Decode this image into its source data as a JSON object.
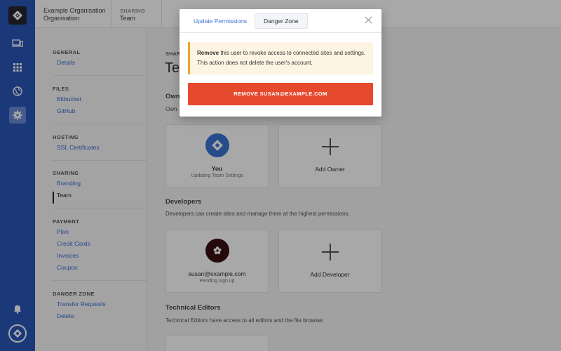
{
  "header": {
    "crumb1_line1": "Example Organisation",
    "crumb1_line2": "Organisation",
    "crumb2_line1": "SHARING",
    "crumb2_line2": "Team"
  },
  "rail": {
    "icons": [
      "logo-icon",
      "devices-icon",
      "apps-grid-icon",
      "globe-icon",
      "gear-icon",
      "bell-icon",
      "account-avatar-icon"
    ],
    "color": "#2a57b8"
  },
  "settings_nav": {
    "sections": [
      {
        "title": "GENERAL",
        "links": [
          "Details"
        ]
      },
      {
        "title": "FILES",
        "links": [
          "Bitbucket",
          "GitHub"
        ]
      },
      {
        "title": "HOSTING",
        "links": [
          "SSL Certificates"
        ]
      },
      {
        "title": "SHARING",
        "links": [
          "Branding",
          "Team"
        ]
      },
      {
        "title": "PAYMENT",
        "links": [
          "Plan",
          "Credit Cards",
          "Invoices",
          "Coupon"
        ]
      },
      {
        "title": "DANGER ZONE",
        "links": [
          "Transfer Requests",
          "Delete"
        ]
      }
    ],
    "current": "Team"
  },
  "main": {
    "label_fragment": "SHAR",
    "title_fragment": "Tea",
    "owners_heading_fragment": "Own",
    "owners_desc_fragment": "Own",
    "owner_card": {
      "name": "You",
      "sub": "Updating Team Settings"
    },
    "add_owner": "Add Owner",
    "developers_heading": "Developers",
    "developers_desc": "Developers can create sites and manage them at the highest permissions.",
    "developer_card": {
      "name": "susan@example.com",
      "sub": "Pending sign up"
    },
    "add_developer": "Add Developer",
    "editors_heading": "Technical Editors",
    "editors_desc": "Technical Editors have access to all editors and the file browser."
  },
  "modal": {
    "tabs": [
      "Update Permissions",
      "Danger Zone"
    ],
    "active_tab": "Danger Zone",
    "warning_bold": "Remove",
    "warning_rest": " this user to revoke access to connected sites and settings. This action does not delete the user's account.",
    "remove_button": "REMOVE SUSAN@EXAMPLE.COM",
    "danger_color": "#e64a2e",
    "warning_accent": "#f0a52a"
  }
}
